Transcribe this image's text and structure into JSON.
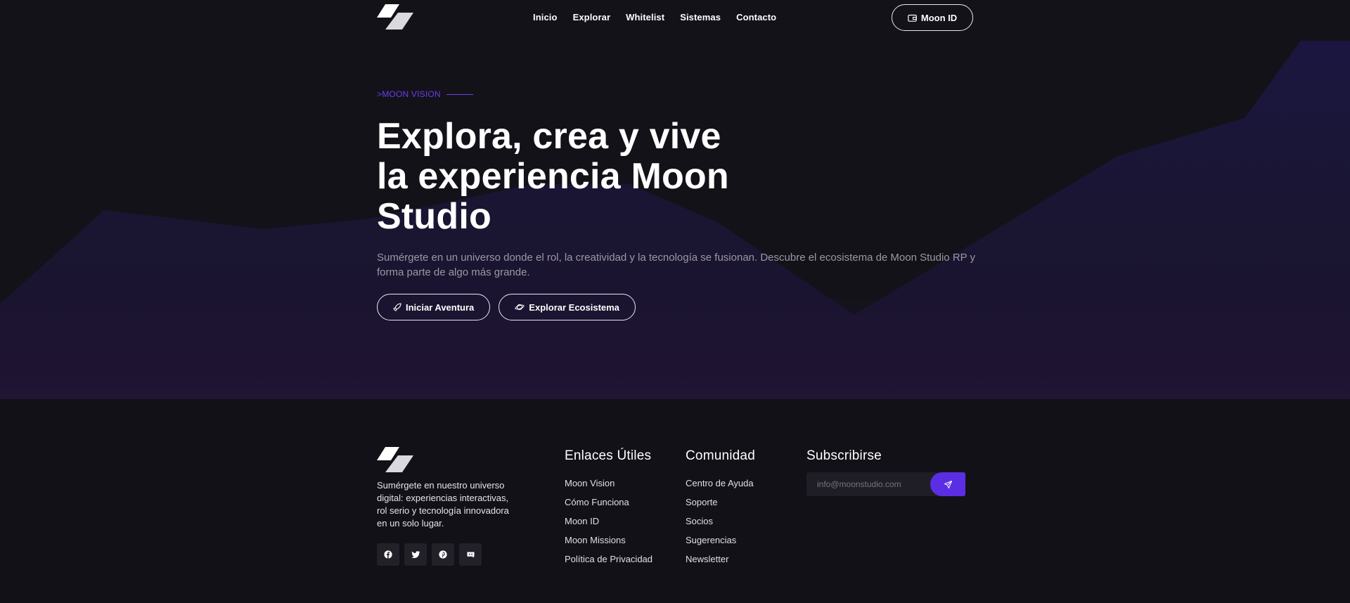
{
  "header": {
    "nav": [
      "Inicio",
      "Explorar",
      "Whitelist",
      "Sistemas",
      "Contacto"
    ],
    "account_button": "Moon ID"
  },
  "hero": {
    "eyebrow": ">MOON VISION",
    "title_line1": "Explora, crea y vive",
    "title_line2": "la experiencia Moon",
    "title_line3": "Studio",
    "description": "Sumérgete en un universo donde el rol, la creatividad y la tecnología se fusionan. Descubre el ecosistema de Moon Studio RP y forma parte de algo más grande.",
    "primary_button": "Iniciar Aventura",
    "secondary_button": "Explorar Ecosistema"
  },
  "footer": {
    "description": "Sumérgete en nuestro universo digital: experiencias interactivas, rol serio y tecnología innovadora en un solo lugar.",
    "socials": [
      "facebook-icon",
      "twitter-icon",
      "pinterest-icon",
      "discord-icon"
    ],
    "links_title": "Enlaces Útiles",
    "links": [
      "Moon Vision",
      "Cómo Funciona",
      "Moon ID",
      "Moon Missions",
      "Política de Privacidad"
    ],
    "community_title": "Comunidad",
    "community": [
      "Centro de Ayuda",
      "Soporte",
      "Socios",
      "Sugerencias",
      "Newsletter"
    ],
    "subscribe_title": "Subscribirse",
    "subscribe_placeholder": "info@moonstudio.com"
  },
  "colors": {
    "accent": "#5b2ee6",
    "eyebrow": "#6b3cf0",
    "background": "#121118"
  }
}
